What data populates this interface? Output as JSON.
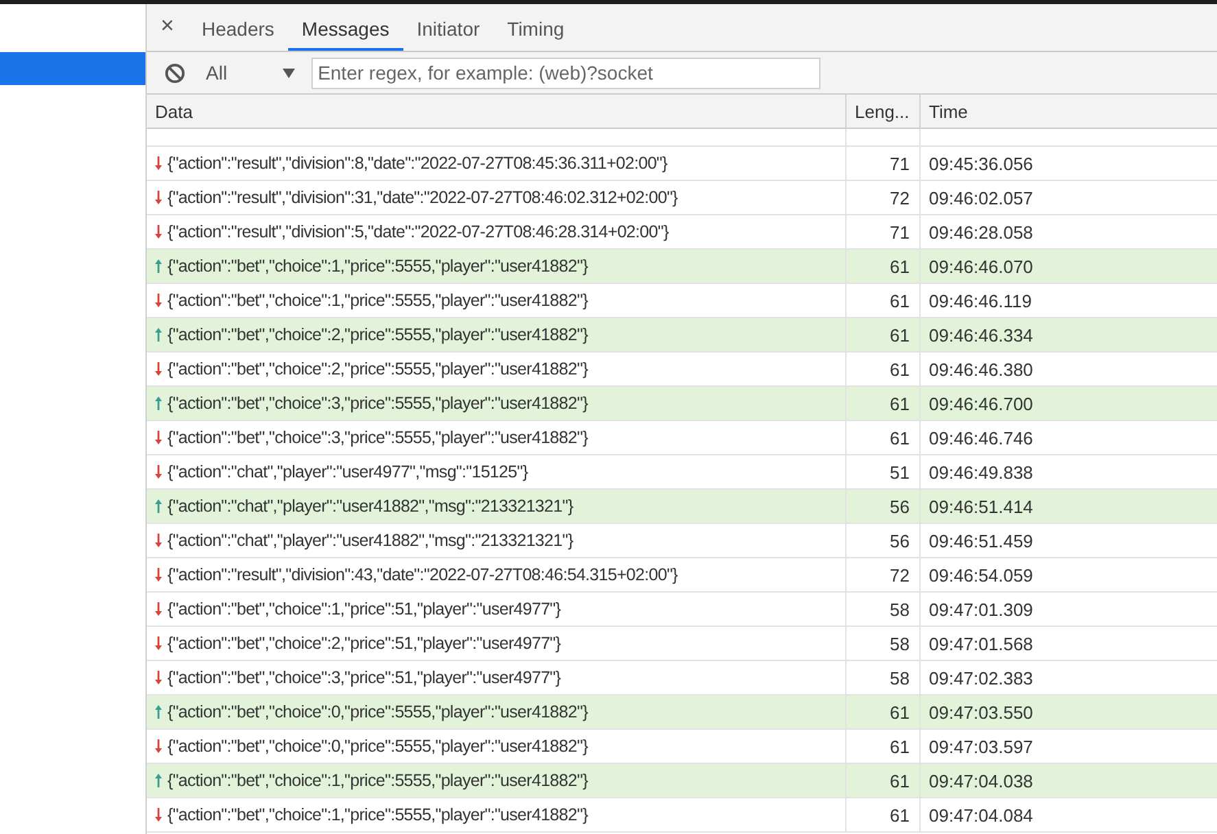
{
  "request_list": {
    "items": [
      {
        "selected": true
      }
    ]
  },
  "tabs_bar": {
    "close": "×",
    "tabs": [
      {
        "label": "Headers",
        "selected": false
      },
      {
        "label": "Messages",
        "selected": true
      },
      {
        "label": "Initiator",
        "selected": false
      },
      {
        "label": "Timing",
        "selected": false
      }
    ]
  },
  "filter_bar": {
    "type": "All",
    "placeholder": "Enter regex, for example: (web)?socket"
  },
  "table": {
    "columns": [
      "Data",
      "Leng...",
      "Time"
    ],
    "rows": [
      {
        "kind": "received",
        "data": "{\"action\":\"result\",\"division\":8,\"date\":\"2022-07-27T08:45:36.311+02:00\"}",
        "length": "71",
        "time": "09:45:36.056"
      },
      {
        "kind": "received",
        "data": "{\"action\":\"result\",\"division\":31,\"date\":\"2022-07-27T08:46:02.312+02:00\"}",
        "length": "72",
        "time": "09:46:02.057"
      },
      {
        "kind": "received",
        "data": "{\"action\":\"result\",\"division\":5,\"date\":\"2022-07-27T08:46:28.314+02:00\"}",
        "length": "71",
        "time": "09:46:28.058"
      },
      {
        "kind": "sent",
        "data": "{\"action\":\"bet\",\"choice\":1,\"price\":5555,\"player\":\"user41882\"}",
        "length": "61",
        "time": "09:46:46.070"
      },
      {
        "kind": "received",
        "data": "{\"action\":\"bet\",\"choice\":1,\"price\":5555,\"player\":\"user41882\"}",
        "length": "61",
        "time": "09:46:46.119"
      },
      {
        "kind": "sent",
        "data": "{\"action\":\"bet\",\"choice\":2,\"price\":5555,\"player\":\"user41882\"}",
        "length": "61",
        "time": "09:46:46.334"
      },
      {
        "kind": "received",
        "data": "{\"action\":\"bet\",\"choice\":2,\"price\":5555,\"player\":\"user41882\"}",
        "length": "61",
        "time": "09:46:46.380"
      },
      {
        "kind": "sent",
        "data": "{\"action\":\"bet\",\"choice\":3,\"price\":5555,\"player\":\"user41882\"}",
        "length": "61",
        "time": "09:46:46.700"
      },
      {
        "kind": "received",
        "data": "{\"action\":\"bet\",\"choice\":3,\"price\":5555,\"player\":\"user41882\"}",
        "length": "61",
        "time": "09:46:46.746"
      },
      {
        "kind": "received",
        "data": "{\"action\":\"chat\",\"player\":\"user4977\",\"msg\":\"15125\"}",
        "length": "51",
        "time": "09:46:49.838"
      },
      {
        "kind": "sent",
        "data": "{\"action\":\"chat\",\"player\":\"user41882\",\"msg\":\"213321321\"}",
        "length": "56",
        "time": "09:46:51.414"
      },
      {
        "kind": "received",
        "data": "{\"action\":\"chat\",\"player\":\"user41882\",\"msg\":\"213321321\"}",
        "length": "56",
        "time": "09:46:51.459"
      },
      {
        "kind": "received",
        "data": "{\"action\":\"result\",\"division\":43,\"date\":\"2022-07-27T08:46:54.315+02:00\"}",
        "length": "72",
        "time": "09:46:54.059"
      },
      {
        "kind": "received",
        "data": "{\"action\":\"bet\",\"choice\":1,\"price\":51,\"player\":\"user4977\"}",
        "length": "58",
        "time": "09:47:01.309"
      },
      {
        "kind": "received",
        "data": "{\"action\":\"bet\",\"choice\":2,\"price\":51,\"player\":\"user4977\"}",
        "length": "58",
        "time": "09:47:01.568"
      },
      {
        "kind": "received",
        "data": "{\"action\":\"bet\",\"choice\":3,\"price\":51,\"player\":\"user4977\"}",
        "length": "58",
        "time": "09:47:02.383"
      },
      {
        "kind": "sent",
        "data": "{\"action\":\"bet\",\"choice\":0,\"price\":5555,\"player\":\"user41882\"}",
        "length": "61",
        "time": "09:47:03.550"
      },
      {
        "kind": "received",
        "data": "{\"action\":\"bet\",\"choice\":0,\"price\":5555,\"player\":\"user41882\"}",
        "length": "61",
        "time": "09:47:03.597"
      },
      {
        "kind": "sent",
        "data": "{\"action\":\"bet\",\"choice\":1,\"price\":5555,\"player\":\"user41882\"}",
        "length": "61",
        "time": "09:47:04.038"
      },
      {
        "kind": "received",
        "data": "{\"action\":\"bet\",\"choice\":1,\"price\":5555,\"player\":\"user41882\"}",
        "length": "61",
        "time": "09:47:04.084"
      }
    ]
  }
}
